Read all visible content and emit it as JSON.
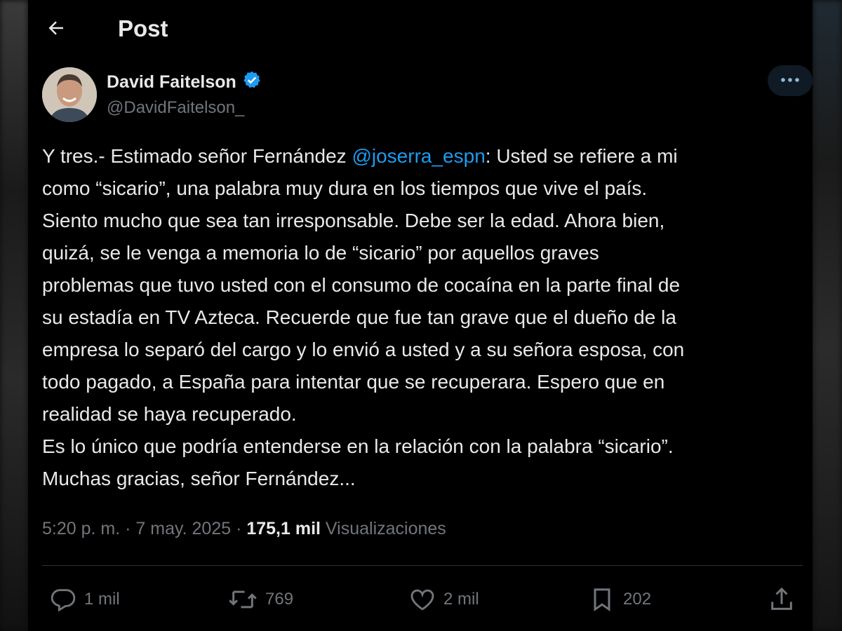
{
  "header": {
    "title": "Post"
  },
  "author": {
    "name": "David Faitelson",
    "handle": "@DavidFaitelson_",
    "verified": true
  },
  "tweet": {
    "lines": [
      [
        "Y tres.- Estimado señor Fernández ",
        "@joserra_espn",
        ": Usted se refiere a mi"
      ],
      "como “sicario”, una palabra muy dura en los tiempos que vive el país.",
      "Siento mucho que sea tan irresponsable. Debe ser la edad. Ahora bien,",
      "quizá, se le venga a memoria lo de “sicario” por aquellos graves",
      "problemas que tuvo usted con el consumo de cocaína en la parte final de",
      "su estadía en TV Azteca. Recuerde que fue tan grave que el dueño de la",
      "empresa lo separó del cargo y lo envió a usted y a su señora esposa, con",
      "todo pagado, a España para intentar que se recuperara. Espero que en",
      "realidad se haya recuperado.",
      "Es lo único que podría entenderse en la relación con la palabra “sicario”.",
      "Muchas gracias, señor Fernández..."
    ]
  },
  "meta": {
    "time": "5:20 p. m.",
    "sep1": " · ",
    "date": "7 may. 2025",
    "sep2": " · ",
    "views_count": "175,1 mil",
    "views_label": " Visualizaciones"
  },
  "actions": {
    "replies": "1 mil",
    "reposts": "769",
    "likes": "2 mil",
    "bookmarks": "202"
  },
  "icons": {
    "back": "arrow-left-icon",
    "verified": "verified-badge-icon",
    "more": "more-icon",
    "reply": "reply-icon",
    "repost": "repost-icon",
    "like": "heart-icon",
    "bookmark": "bookmark-icon",
    "share": "share-icon"
  },
  "colors": {
    "background": "#000000",
    "text": "#e7e9ea",
    "muted": "#71767b",
    "accent": "#1d9bf0"
  }
}
